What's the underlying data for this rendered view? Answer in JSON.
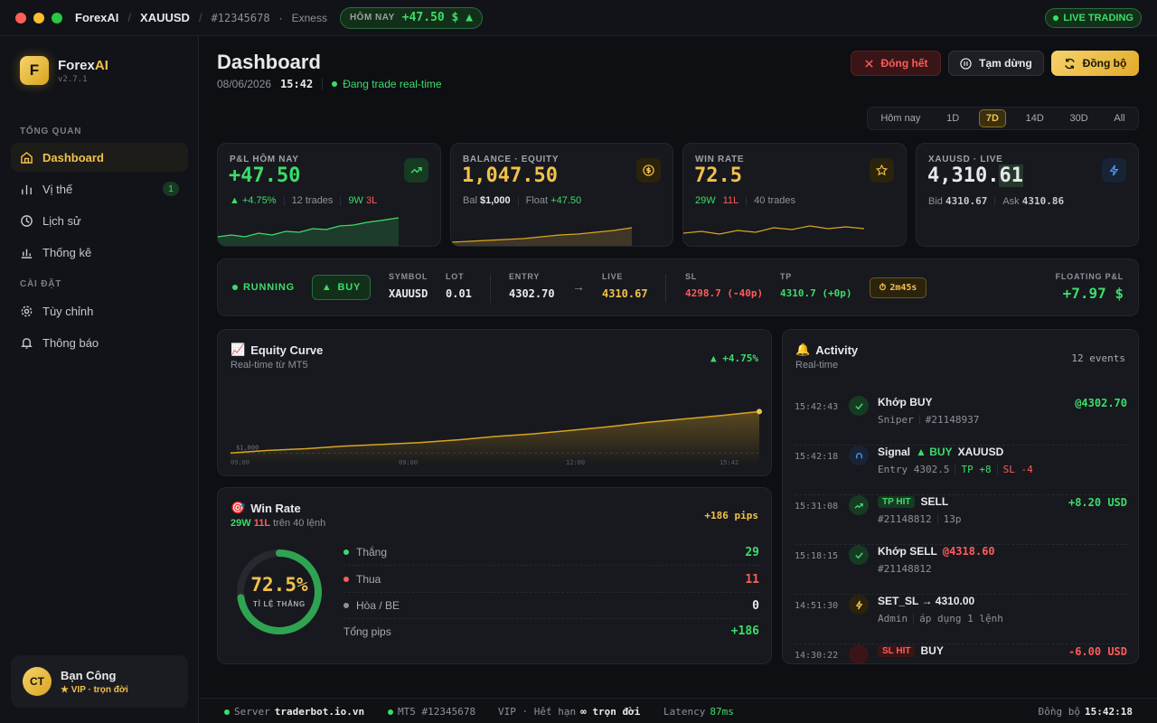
{
  "titlebar": {
    "app": "ForexAI",
    "symbol": "XAUUSD",
    "account": "#12345678",
    "broker": "Exness",
    "today_label": "HÔM NAY",
    "today_value": "+47.50 $ ▲",
    "live": "LIVE TRADING"
  },
  "sidebar": {
    "logo_letter": "F",
    "logo_name_a": "Forex",
    "logo_name_b": "AI",
    "version": "v2.7.1",
    "section_overview": "TỔNG QUAN",
    "section_settings": "CÀI ĐẶT",
    "items": [
      {
        "label": "Dashboard"
      },
      {
        "label": "Vị thế",
        "badge": "1"
      },
      {
        "label": "Lịch sử"
      },
      {
        "label": "Thống kê"
      },
      {
        "label": "Tùy chỉnh"
      },
      {
        "label": "Thông báo"
      }
    ],
    "user": {
      "initials": "CT",
      "name": "Bạn Công",
      "plan": "★ VIP · trọn đời"
    }
  },
  "header": {
    "title": "Dashboard",
    "date": "08/06/2026",
    "time": "15:42",
    "status": "Đang trade real-time",
    "btn_close_all": "Đóng hết",
    "btn_pause": "Tạm dừng",
    "btn_sync": "Đồng bộ"
  },
  "ranges": [
    "Hôm nay",
    "1D",
    "7D",
    "14D",
    "30D",
    "All"
  ],
  "kpi": {
    "pnl": {
      "label": "P&L HÔM NAY",
      "value": "+47.50",
      "pct": "▲ +4.75%",
      "trades": "12 trades",
      "w": "9W",
      "l": "3L"
    },
    "balance": {
      "label": "BALANCE · EQUITY",
      "value": "1,047.50",
      "bal_label": "Bal",
      "bal": "$1,000",
      "float_label": "Float",
      "float": "+47.50"
    },
    "winrate": {
      "label": "WIN RATE",
      "value": "72.5",
      "w": "29W",
      "l": "11L",
      "trades": "40 trades"
    },
    "live": {
      "label": "XAUUSD · LIVE",
      "value_a": "4,310.",
      "value_b": "61",
      "bid_label": "Bid",
      "bid": "4310.67",
      "ask_label": "Ask",
      "ask": "4310.86"
    }
  },
  "position": {
    "status": "RUNNING",
    "side": "BUY",
    "symbol_label": "SYMBOL",
    "symbol": "XAUUSD",
    "lot_label": "LOT",
    "lot": "0.01",
    "entry_label": "ENTRY",
    "entry": "4302.70",
    "live_label": "LIVE",
    "live": "4310.67",
    "sl_label": "SL",
    "sl": "4298.7 (-40p)",
    "tp_label": "TP",
    "tp": "4310.7 (+0p)",
    "duration": "2m45s",
    "float_label": "FLOATING P&L",
    "float": "+7.97 $"
  },
  "equity": {
    "title": "Equity Curve",
    "sub": "Real-time từ MT5",
    "change": "▲ +4.75%",
    "chart_data": {
      "type": "area",
      "title": "Equity Curve",
      "x": [
        "09:00",
        "09:30",
        "10:00",
        "10:30",
        "11:00",
        "11:30",
        "12:00",
        "12:30",
        "13:00",
        "13:30",
        "14:00",
        "14:30",
        "15:00",
        "15:30",
        "15:42"
      ],
      "values": [
        1000,
        1003,
        1005,
        1008,
        1010,
        1012,
        1015,
        1019,
        1022,
        1026,
        1030,
        1035,
        1039,
        1043,
        1047.5
      ],
      "ref_label": "$1,000",
      "tick_labels": [
        "09:00",
        "09:00",
        "12:00",
        "15:42"
      ],
      "ylim": [
        990,
        1050
      ]
    }
  },
  "winrate": {
    "title": "Win Rate",
    "w": "29W",
    "l": "11L",
    "tail": "trên 40 lệnh",
    "pips": "+186 pips",
    "pct": "72.5%",
    "ring_label": "TỈ LỆ THẮNG",
    "ratio": 0.725,
    "rows": [
      {
        "label": "Thắng",
        "value": "29"
      },
      {
        "label": "Thua",
        "value": "11"
      },
      {
        "label": "Hòa / BE",
        "value": "0"
      },
      {
        "label": "Tổng pips",
        "value": "+186"
      }
    ],
    "colors": {
      "win": "#3ddc6a",
      "loss": "#ff5b5b",
      "be": "#8d919a"
    }
  },
  "activity": {
    "title": "Activity",
    "sub": "Real-time",
    "count": "12 events",
    "events": [
      {
        "time": "15:42:43",
        "title": "Khớp BUY",
        "desc_a": "Sniper",
        "desc_b": "#21148937",
        "amount": "@4302.70"
      },
      {
        "time": "15:42:18",
        "title_a": "Signal",
        "title_b": "▲ BUY",
        "title_c": "XAUUSD",
        "desc_a": "Entry 4302.5",
        "desc_b": "TP +8",
        "desc_c": "SL -4"
      },
      {
        "time": "15:31:08",
        "tag": "TP HIT",
        "title": "SELL",
        "desc_a": "#21148812",
        "desc_b": "13p",
        "amount": "+8.20 USD"
      },
      {
        "time": "15:18:15",
        "title_a": "Khớp SELL",
        "title_b": "@4318.60",
        "desc_a": "#21148812"
      },
      {
        "time": "14:51:30",
        "title": "SET_SL → 4310.00",
        "desc_a": "Admin",
        "desc_b": "áp dụng 1 lệnh"
      },
      {
        "time": "14:30:22",
        "tag": "SL HIT",
        "title": "BUY",
        "amount": "-6.00 USD"
      }
    ]
  },
  "footer": {
    "server_label": "Server",
    "server": "traderbot.io.vn",
    "mt5": "MT5 #12345678",
    "vip_a": "VIP · Hết hạn",
    "vip_b": "∞ trọn đời",
    "latency_label": "Latency",
    "latency": "87ms",
    "sync_label": "Đồng bộ",
    "sync_time": "15:42:18"
  }
}
